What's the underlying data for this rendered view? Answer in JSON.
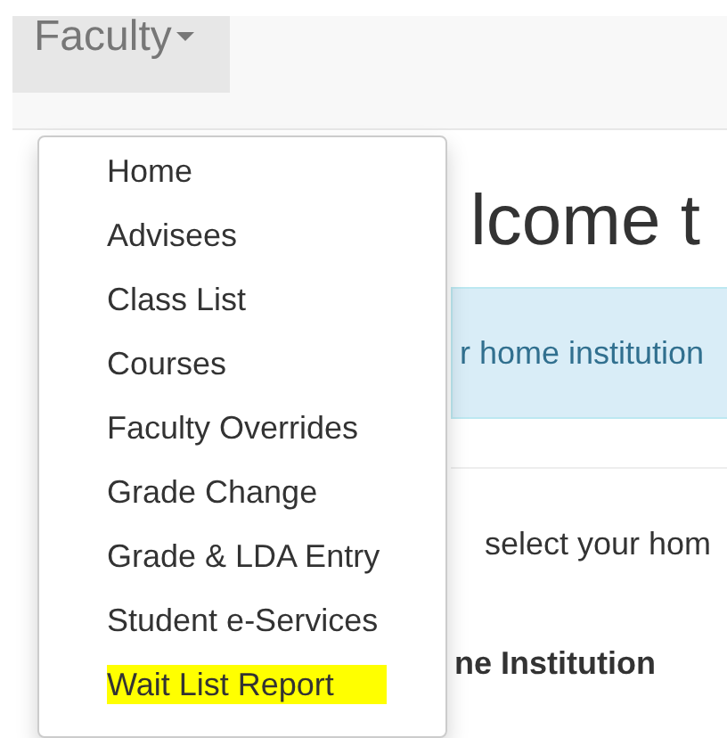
{
  "navbar": {
    "menu_label": "Faculty",
    "expanded": true
  },
  "dropdown": {
    "items": [
      {
        "label": "Home",
        "highlighted": false
      },
      {
        "label": "Advisees",
        "highlighted": false
      },
      {
        "label": "Class List",
        "highlighted": false
      },
      {
        "label": "Courses",
        "highlighted": false
      },
      {
        "label": "Faculty Overrides",
        "highlighted": false
      },
      {
        "label": "Grade Change",
        "highlighted": false
      },
      {
        "label": "Grade & LDA Entry",
        "highlighted": false
      },
      {
        "label": "Student e-Services",
        "highlighted": false
      },
      {
        "label": "Wait List Report",
        "highlighted": true
      }
    ]
  },
  "content": {
    "heading": "lcome t",
    "alert": "r home institution",
    "instruction": "select your hom",
    "field_label": "ne Institution"
  }
}
